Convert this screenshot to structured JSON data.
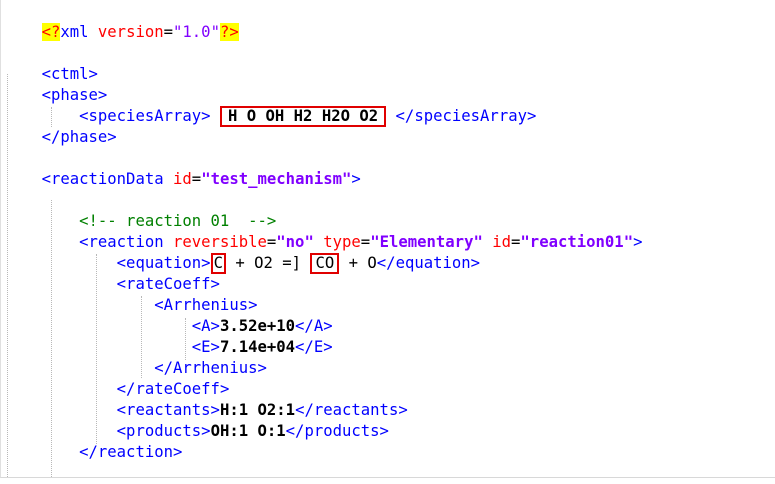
{
  "code": {
    "pi_open": "<?",
    "pi_name": "xml",
    "pi_attr": "version",
    "pi_value": "\"1.0\"",
    "pi_close": "?>",
    "ctml_open": "<ctml>",
    "phase_open": "<phase>",
    "species_open": "<speciesArray>",
    "species_list": "H O OH H2 H2O O2",
    "species_close": "</speciesArray>",
    "phase_close": "</phase>",
    "reactiondata_open": "<reactionData",
    "reactiondata_attr": "id",
    "reactiondata_id": "\"test_mechanism\"",
    "tag_end": ">",
    "equals": "=",
    "comment": "<!-- reaction 01  -->",
    "reaction_open": "<reaction",
    "reversible_attr": "reversible",
    "reversible_value": "\"no\"",
    "type_attr": "type",
    "type_value": "\"Elementary\"",
    "id_attr": "id",
    "reaction_id": "\"reaction01\"",
    "equation_open": "<equation>",
    "eq_reactant": "C",
    "eq_middle": " + O2 =] ",
    "eq_product": "CO",
    "eq_end": " + O",
    "equation_close": "</equation>",
    "ratecoeff_open": "<rateCoeff>",
    "arrhenius_open": "<Arrhenius>",
    "a_open": "<A>",
    "a_value": "3.52e+10",
    "a_close": "</A>",
    "e_open": "<E>",
    "e_value": "7.14e+04",
    "e_close": "</E>",
    "arrhenius_close": "</Arrhenius>",
    "ratecoeff_close": "</rateCoeff>",
    "reactants_open": "<reactants>",
    "reactants_value": "H:1 O2:1",
    "reactants_close": "</reactants>",
    "products_open": "<products>",
    "products_value": "OH:1 O:1",
    "products_close": "</products>",
    "reaction_close": "</reaction>"
  },
  "colors": {
    "tag": "#0000ff",
    "attribute": "#ff0000",
    "value": "#8000ff",
    "comment": "#008000",
    "highlight_box": "#e00000",
    "pi_background": "#ffff00"
  }
}
